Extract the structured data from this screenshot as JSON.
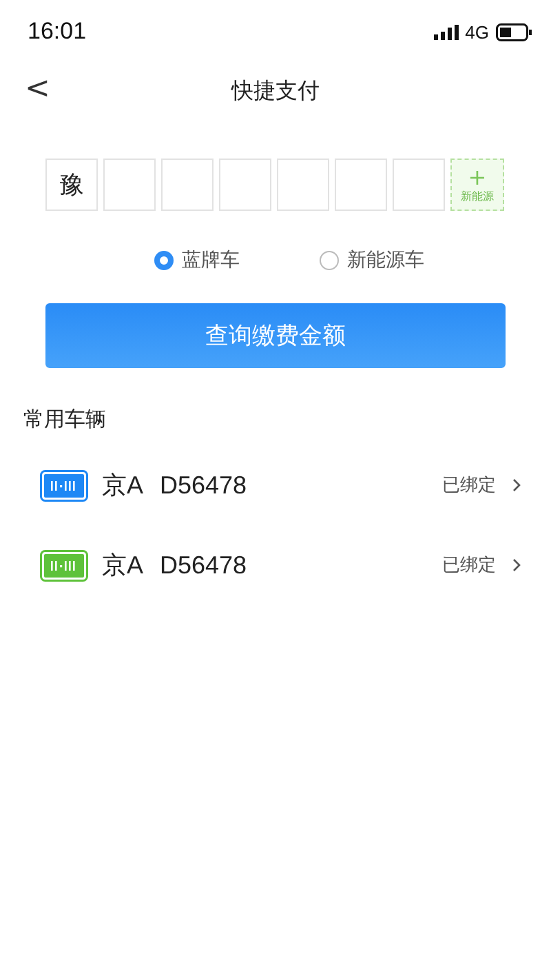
{
  "status_bar": {
    "time": "16:01",
    "network": "4G"
  },
  "nav": {
    "back": "<",
    "title": "快捷支付"
  },
  "plate_input": {
    "cells": [
      {
        "kind": "text",
        "value": "豫"
      },
      {
        "kind": "empty"
      },
      {
        "kind": "empty"
      },
      {
        "kind": "empty"
      },
      {
        "kind": "empty"
      },
      {
        "kind": "empty"
      },
      {
        "kind": "empty"
      },
      {
        "kind": "new-energy",
        "icon": "+",
        "label": "新能源"
      }
    ]
  },
  "plate_types": [
    {
      "label": "蓝牌车",
      "selected": true
    },
    {
      "label": "新能源车",
      "selected": false
    }
  ],
  "query_button": "查询缴费金额",
  "section_title": "常用车辆",
  "vehicles": [
    {
      "region": "京A",
      "number": "D56478",
      "status": "已绑定",
      "color": "#1e88f5"
    },
    {
      "region": "京A",
      "number": "D56478",
      "status": "已绑定",
      "color": "#5ec23a"
    }
  ]
}
